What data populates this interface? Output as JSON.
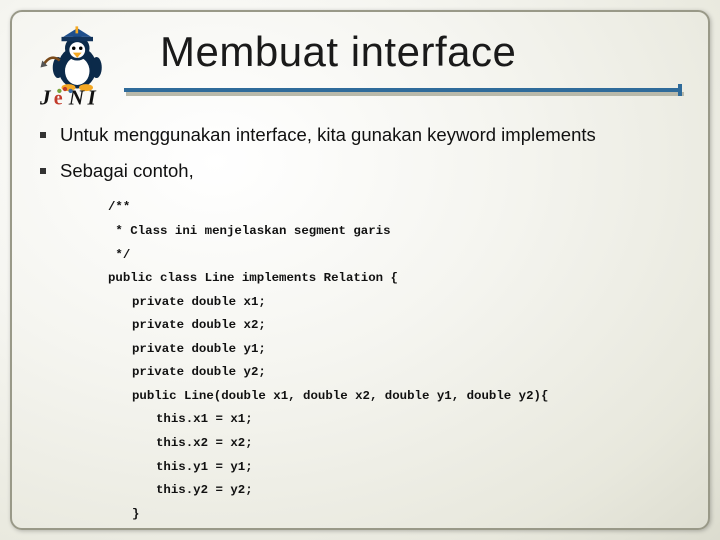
{
  "title": "Membuat interface",
  "bullets": [
    "Untuk menggunakan interface, kita gunakan keyword implements",
    "Sebagai contoh,"
  ],
  "code": [
    {
      "indent": 0,
      "text": "/**"
    },
    {
      "indent": 0,
      "text": " * Class ini menjelaskan segment garis"
    },
    {
      "indent": 0,
      "text": " */"
    },
    {
      "indent": 0,
      "text": "public class Line implements Relation {"
    },
    {
      "indent": 1,
      "text": "private double x1;"
    },
    {
      "indent": 1,
      "text": "private double x2;"
    },
    {
      "indent": 1,
      "text": "private double y1;"
    },
    {
      "indent": 1,
      "text": "private double y2;"
    },
    {
      "indent": 1,
      "text": "public Line(double x1, double x2, double y1, double y2){"
    },
    {
      "indent": 2,
      "text": "this.x1 = x1;"
    },
    {
      "indent": 2,
      "text": "this.x2 = x2;"
    },
    {
      "indent": 2,
      "text": "this.y1 = y1;"
    },
    {
      "indent": 2,
      "text": "this.y2 = y2;"
    },
    {
      "indent": 1,
      "text": "}"
    }
  ]
}
